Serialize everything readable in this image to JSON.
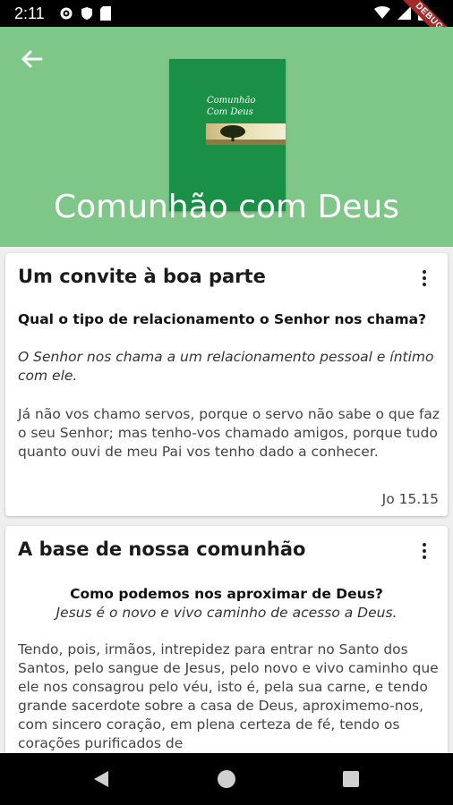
{
  "status_bar": {
    "time": "2:11",
    "left_icons": [
      "gear-icon",
      "shield-icon",
      "sd-card-icon"
    ],
    "right_icons": [
      "wifi-icon",
      "signal-icon",
      "battery-icon"
    ]
  },
  "debug_banner": "DEBUG",
  "header": {
    "background_color": "#7fc689",
    "back_icon": "arrow-back-icon",
    "cover": {
      "title_line1": "Comunhão",
      "title_line2": "Com Deus",
      "background_color": "#1a8f46"
    },
    "title": "Comunhão com Deus"
  },
  "cards": [
    {
      "title": "Um convite à boa parte",
      "menu_icon": "more-vert-icon",
      "question": "Qual o tipo de relacionamento o Senhor nos chama?",
      "answer": "O Senhor nos chama a um relacionamento pessoal e íntimo com ele.",
      "verse": "Já não vos chamo servos, porque o servo não sabe o que faz o seu Senhor; mas tenho-vos chamado amigos, porque tudo quanto ouvi de meu Pai vos tenho dado a conhecer.",
      "reference": "Jo 15.15"
    },
    {
      "title": "A base de nossa comunhão",
      "menu_icon": "more-vert-icon",
      "question": "Como podemos nos aproximar de Deus?",
      "answer": "Jesus é o novo e vivo caminho de acesso a Deus.",
      "verse": "Tendo, pois, irmãos, intrepidez para entrar no Santo dos Santos, pelo sangue de Jesus, pelo novo e vivo caminho que ele nos consagrou pelo véu, isto é, pela sua carne, e tendo grande sacerdote sobre a casa de Deus, aproximemo-nos, com sincero coração, em plena certeza de fé, tendo os corações purificados de"
    }
  ],
  "nav_bar": {
    "icons": [
      "nav-back-icon",
      "nav-home-icon",
      "nav-recents-icon"
    ]
  }
}
